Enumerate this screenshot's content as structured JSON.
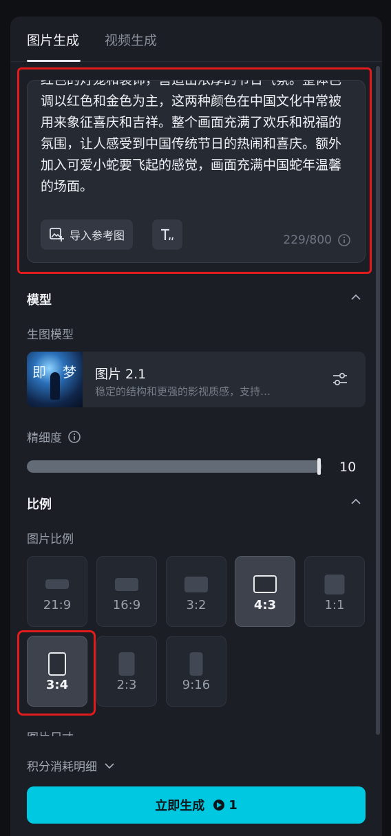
{
  "tabs": [
    {
      "label": "图片生成",
      "active": true
    },
    {
      "label": "视频生成",
      "active": false
    }
  ],
  "prompt": {
    "text": "红色的灯笼和装饰，营造出浓厚的节日气氛。整体色调以红色和金色为主，这两种颜色在中国文化中常被用来象征喜庆和吉祥。整个画面充满了欢乐和祝福的氛围，让人感受到中国传统节日的热闹和喜庆。额外加入可爱小蛇要飞起的感觉，画面充满中国蛇年温馨的场面。",
    "import_ref_label": "导入参考图",
    "char_count": "229/800"
  },
  "model_section": {
    "title": "模型",
    "sub_label": "生图模型",
    "model": {
      "name": "图片 2.1",
      "description": "稳定的结构和更强的影视质感，支持…",
      "thumb_text_left": "即",
      "thumb_text_right": "梦"
    },
    "detail_label": "精细度",
    "detail_value": "10",
    "detail_fraction": 1.0
  },
  "ratio_section": {
    "title": "比例",
    "sub_label": "图片比例",
    "ratios": [
      "21:9",
      "16:9",
      "3:2",
      "4:3",
      "1:1",
      "3:4",
      "2:3",
      "9:16"
    ],
    "selected": [
      "4:3",
      "3:4"
    ],
    "size_label": "图片尺寸"
  },
  "cost_label": "积分消耗明细",
  "generate": {
    "label": "立即生成",
    "credits": "1"
  },
  "colors": {
    "accent": "#00c8e0",
    "highlight": "#e31b1b"
  }
}
